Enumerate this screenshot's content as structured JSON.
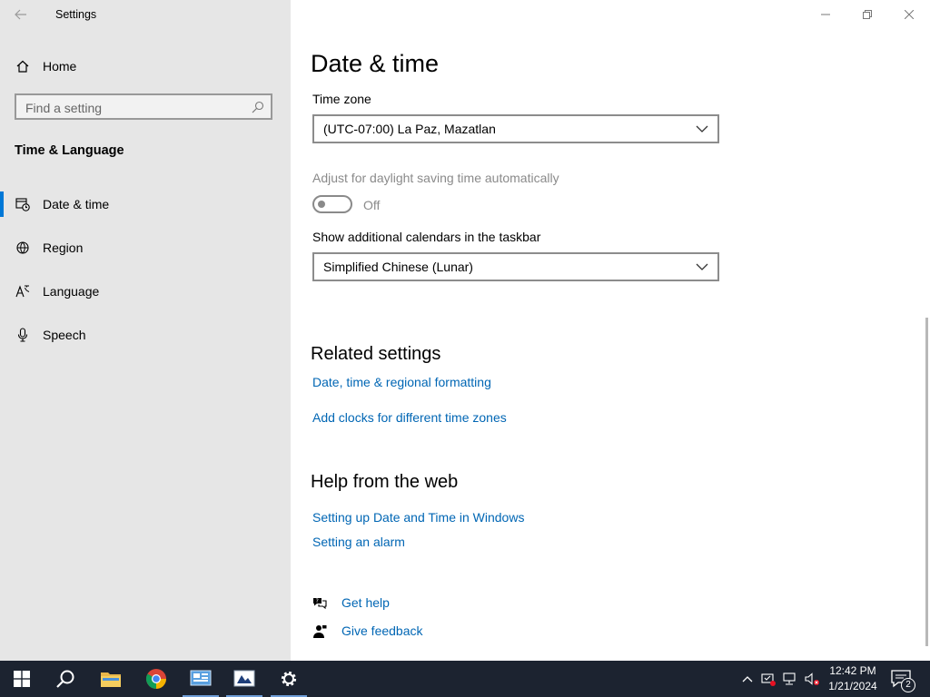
{
  "window": {
    "title": "Settings",
    "controls": {
      "minimize": "minimize",
      "maximize": "restore",
      "close": "close"
    }
  },
  "sidebar": {
    "home_label": "Home",
    "search_placeholder": "Find a setting",
    "section_title": "Time & Language",
    "items": [
      {
        "label": "Date & time",
        "icon": "clock-calendar-icon",
        "active": true
      },
      {
        "label": "Region",
        "icon": "globe-icon",
        "active": false
      },
      {
        "label": "Language",
        "icon": "language-icon",
        "active": false
      },
      {
        "label": "Speech",
        "icon": "microphone-icon",
        "active": false
      }
    ]
  },
  "main": {
    "title": "Date & time",
    "timezone_label": "Time zone",
    "timezone_value": "(UTC-07:00) La Paz, Mazatlan",
    "dst_label": "Adjust for daylight saving time automatically",
    "dst_state": "Off",
    "calendars_label": "Show additional calendars in the taskbar",
    "calendars_value": "Simplified Chinese (Lunar)",
    "related_title": "Related settings",
    "related_links": [
      "Date, time & regional formatting",
      "Add clocks for different time zones"
    ],
    "help_title": "Help from the web",
    "help_links": [
      "Setting up Date and Time in Windows",
      "Setting an alarm"
    ],
    "get_help": "Get help",
    "give_feedback": "Give feedback"
  },
  "taskbar": {
    "apps": [
      "start",
      "search",
      "file-explorer",
      "chrome",
      "control-panel",
      "app",
      "settings"
    ],
    "time": "12:42 PM",
    "date": "1/21/2024",
    "notification_count": "2"
  },
  "colors": {
    "accent": "#0078d7",
    "link": "#0066b4",
    "sidebar_bg": "#e6e6e6",
    "taskbar_bg": "#1c2330"
  }
}
